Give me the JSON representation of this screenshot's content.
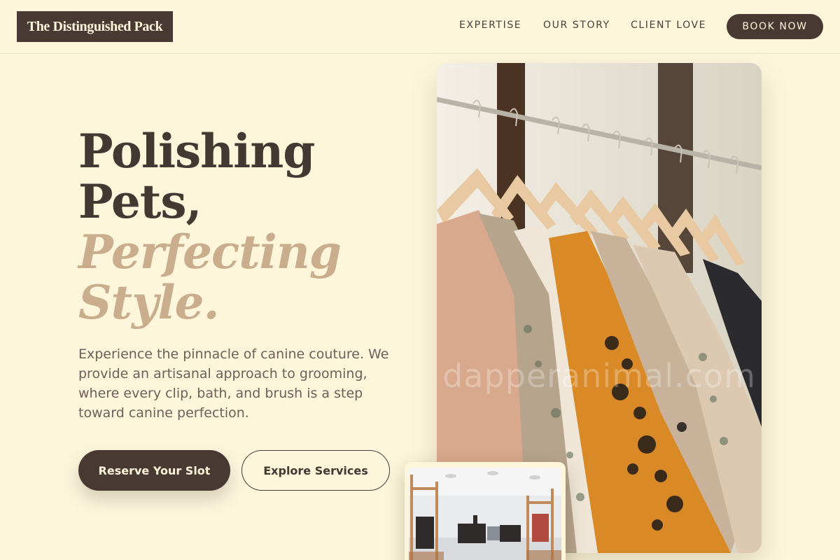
{
  "brand": {
    "name": "The Distinguished Pack"
  },
  "nav": {
    "links": [
      "EXPERTISE",
      "OUR STORY",
      "CLIENT LOVE"
    ],
    "cta": "BOOK NOW"
  },
  "hero": {
    "title_lines": [
      "Polishing",
      "Pets,"
    ],
    "accent_lines": [
      "Perfecting",
      "Style."
    ],
    "description": "Experience the pinnacle of canine couture. We provide an artisanal approach to grooming, where every clip, bath, and brush is a step toward canine perfection.",
    "primary_button": "Reserve Your Slot",
    "secondary_button": "Explore Services"
  },
  "media": {
    "main_image": "clothing-rack-photo",
    "watermark": "dapperanimal.com",
    "thumbnail_image": "boutique-interior-photo"
  },
  "colors": {
    "background": "#fdf6db",
    "primary": "#483a33",
    "accent": "#c9ad8d",
    "body_text": "#6e6058"
  }
}
